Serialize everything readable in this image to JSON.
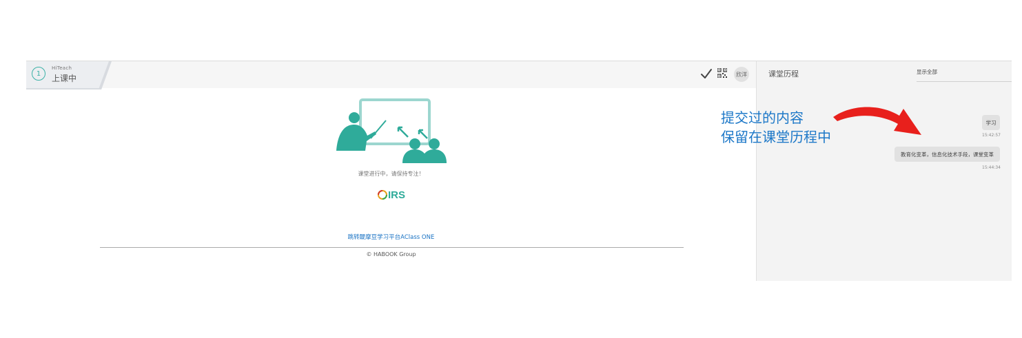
{
  "header": {
    "step_number": "1",
    "brand": "HiTeach",
    "status": "上课中",
    "user": "欣洋"
  },
  "main": {
    "status_message": "课堂进行中，请保持专注！",
    "logo_text": "IRS",
    "jump_link": "跳转醍摩豆学习平台AClass ONE",
    "copyright": "© HABOOK Group"
  },
  "panel": {
    "title": "课堂历程",
    "show_all": "显示全部",
    "messages": [
      {
        "text": "学习",
        "time": "15:42:57"
      },
      {
        "text": "教育化变革，信息化技术手段，课堂变革",
        "time": "15:44:34"
      }
    ]
  },
  "annotation": {
    "line1": "提交过的内容",
    "line2": "保留在课堂历程中"
  },
  "colors": {
    "teal": "#2fab9a",
    "link": "#1a73c4",
    "annotation": "#1d78c8",
    "arrow": "#e8201c"
  },
  "icons": [
    "check-icon",
    "qr-code-icon",
    "arrow-icon"
  ]
}
